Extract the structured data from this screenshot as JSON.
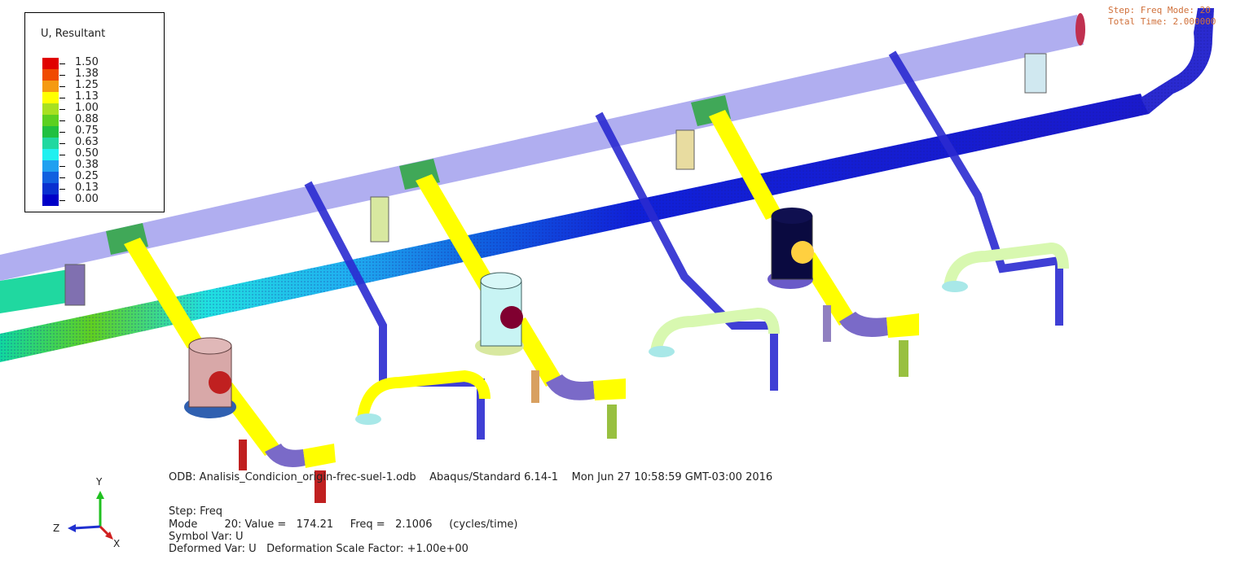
{
  "legend": {
    "title": "U, Resultant",
    "entries": [
      {
        "value": "1.50",
        "color": "#e00000"
      },
      {
        "value": "1.38",
        "color": "#f04a00"
      },
      {
        "value": "1.25",
        "color": "#f59a10"
      },
      {
        "value": "1.13",
        "color": "#ffff00"
      },
      {
        "value": "1.00",
        "color": "#a8e020"
      },
      {
        "value": "0.88",
        "color": "#5cd020"
      },
      {
        "value": "0.75",
        "color": "#20c040"
      },
      {
        "value": "0.63",
        "color": "#20d8a0"
      },
      {
        "value": "0.50",
        "color": "#20f0f0"
      },
      {
        "value": "0.38",
        "color": "#20a0f0"
      },
      {
        "value": "0.25",
        "color": "#1060e0"
      },
      {
        "value": "0.13",
        "color": "#0830d0"
      },
      {
        "value": "0.00",
        "color": "#0000c8"
      }
    ]
  },
  "status": {
    "line1": "Step: Freq      Mode: 20",
    "line2": "Total Time: 2.000000"
  },
  "info": {
    "odb": "ODB: Analisis_Condicion_origin-frec-suel-1.odb    Abaqus/Standard 6.14-1    Mon Jun 27 10:58:59 GMT-03:00 2016",
    "step": "Step: Freq",
    "mode": "Mode        20: Value =   174.21     Freq =   2.1006     (cycles/time)",
    "symbol": "Symbol Var: U",
    "deformed": "Deformed Var: U   Deformation Scale Factor: +1.00e+00"
  },
  "triad": {
    "y": "Y",
    "z": "Z",
    "x": "X"
  },
  "colors": {
    "header_pipe": "#b0aef0",
    "branch_pipe": "#ffff00",
    "elbow": "#7a6ac8",
    "lower_pipe": "#1a1acc",
    "mesh": "#2020a0"
  }
}
